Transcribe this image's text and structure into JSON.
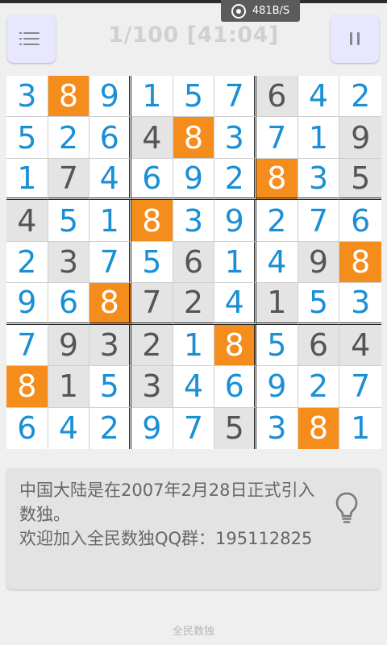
{
  "status": {
    "net_speed": "481B/S",
    "net_icon": "hotspot-icon"
  },
  "header": {
    "title": "1/100 [41:04]",
    "menu_icon": "menu-icon",
    "pause_icon": "pause-icon"
  },
  "board": {
    "highlight_digit": 8,
    "rows": [
      [
        3,
        8,
        9,
        1,
        5,
        7,
        6,
        4,
        2
      ],
      [
        5,
        2,
        6,
        4,
        8,
        3,
        7,
        1,
        9
      ],
      [
        1,
        7,
        4,
        6,
        9,
        2,
        8,
        3,
        5
      ],
      [
        4,
        5,
        1,
        8,
        3,
        9,
        2,
        7,
        6
      ],
      [
        2,
        3,
        7,
        5,
        6,
        1,
        4,
        9,
        8
      ],
      [
        9,
        6,
        8,
        7,
        2,
        4,
        1,
        5,
        3
      ],
      [
        7,
        9,
        3,
        2,
        1,
        8,
        5,
        6,
        4
      ],
      [
        8,
        1,
        5,
        3,
        4,
        6,
        9,
        2,
        7
      ],
      [
        6,
        4,
        2,
        9,
        7,
        5,
        3,
        8,
        1
      ]
    ],
    "states": [
      [
        "u",
        "h",
        "u",
        "u",
        "u",
        "u",
        "g",
        "u",
        "u"
      ],
      [
        "u",
        "u",
        "u",
        "g",
        "h",
        "u",
        "u",
        "u",
        "g"
      ],
      [
        "u",
        "g",
        "u",
        "u",
        "u",
        "u",
        "h",
        "u",
        "g"
      ],
      [
        "g",
        "u",
        "u",
        "h",
        "u",
        "u",
        "u",
        "u",
        "u"
      ],
      [
        "u",
        "g",
        "u",
        "u",
        "g",
        "u",
        "u",
        "g",
        "h"
      ],
      [
        "u",
        "u",
        "h",
        "g",
        "g",
        "u",
        "g",
        "u",
        "u"
      ],
      [
        "u",
        "g",
        "g",
        "g",
        "u",
        "h",
        "u",
        "g",
        "g"
      ],
      [
        "h",
        "g",
        "u",
        "g",
        "u",
        "u",
        "u",
        "u",
        "u"
      ],
      [
        "u",
        "u",
        "u",
        "u",
        "u",
        "g",
        "u",
        "h",
        "u"
      ]
    ],
    "colors": {
      "user": "#1a8fd6",
      "given": "#555555",
      "highlight_bg": "#f48d1c"
    }
  },
  "hint": {
    "line1": "中国大陆是在2007年2月28日正式引入数独。",
    "line2": "欢迎加入全民数独QQ群：195112825",
    "icon": "lightbulb-icon"
  },
  "footer": {
    "label": "全民数独"
  }
}
